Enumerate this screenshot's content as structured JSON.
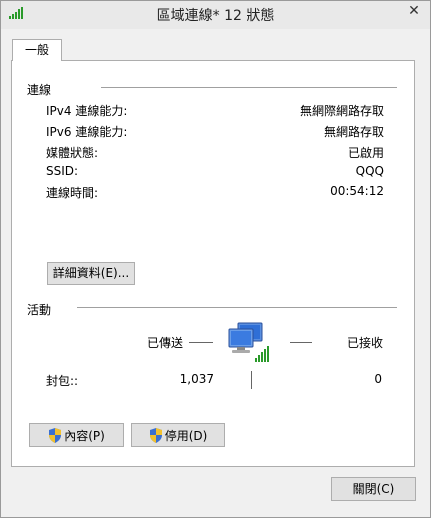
{
  "window": {
    "title": "區域連線* 12 狀態",
    "close_glyph": "✕",
    "app_icon": "network-signal-icon"
  },
  "tabs": [
    {
      "label": "一般"
    }
  ],
  "connection": {
    "group_title": "連線",
    "rows": [
      {
        "label": "IPv4 連線能力:",
        "value": "無網際網路存取"
      },
      {
        "label": "IPv6 連線能力:",
        "value": "無網路存取"
      },
      {
        "label": "媒體狀態:",
        "value": "已啟用"
      },
      {
        "label": "SSID:",
        "value": "QQQ"
      },
      {
        "label": "連線時間:",
        "value": "00:54:12"
      }
    ],
    "details_button": "詳細資料(E)..."
  },
  "activity": {
    "group_title": "活動",
    "sent_label": "已傳送",
    "received_label": "已接收",
    "packets_label": "封包::",
    "packets_sent": "1,037",
    "packets_received": "0",
    "center_icon": "network-computers-icon"
  },
  "buttons": {
    "properties": "內容(P)",
    "disable": "停用(D)",
    "close": "關閉(C)"
  },
  "colors": {
    "signal_green": "#2a9a2a",
    "monitor_blue": "#2f6fd6"
  }
}
